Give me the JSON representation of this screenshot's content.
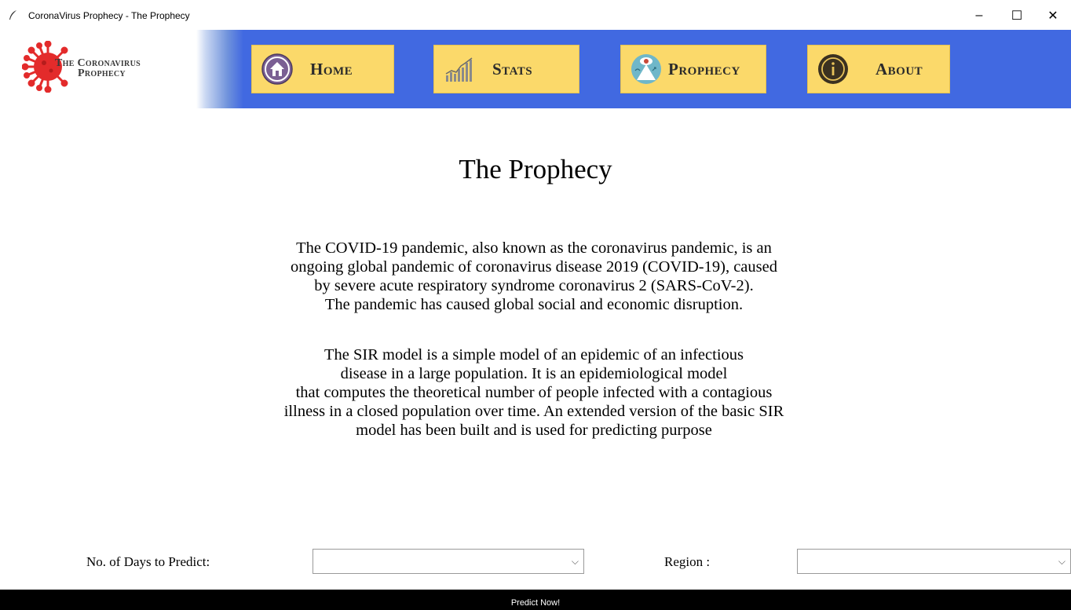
{
  "window": {
    "title": "CoronaVirus Prophecy - The Prophecy",
    "minimize_glyph": "–",
    "maximize_glyph": "☐",
    "close_glyph": "✕"
  },
  "logo": {
    "line1": "The Coronavirus",
    "line2": "Prophecy",
    "icon": "virus-icon",
    "color": "#e32b2b"
  },
  "nav": {
    "home": {
      "label": "Home",
      "icon": "house-icon"
    },
    "stats": {
      "label": "Stats",
      "icon": "bar-chart-icon"
    },
    "prophecy": {
      "label": "Prophecy",
      "icon": "prophecy-eye-icon"
    },
    "about": {
      "label": "About",
      "icon": "info-icon"
    }
  },
  "page": {
    "title": "The Prophecy",
    "paragraph1": [
      "The COVID-19 pandemic, also known as the coronavirus pandemic, is an",
      "ongoing global pandemic of coronavirus disease 2019 (COVID-19), caused",
      "by severe acute respiratory syndrome coronavirus 2 (SARS-CoV-2).",
      "The pandemic has caused global social and economic disruption."
    ],
    "paragraph2": [
      "The SIR model is a simple model of an epidemic of an infectious",
      "disease in a large population. It is an epidemiological model",
      "that computes the theoretical number of people infected with a contagious",
      "illness in a closed population over time. An extended version of the basic SIR",
      "model has been built and is used for predicting purpose"
    ]
  },
  "form": {
    "days_label": "No. of Days to Predict:",
    "days_value": "",
    "region_label": "Region :",
    "region_value": "",
    "dropdown_glyph": "⌵",
    "predict_button": "Predict Now!"
  },
  "colors": {
    "header_bg": "#4169e1",
    "nav_button_bg": "#fbd96a",
    "predict_bar_bg": "#000000"
  }
}
